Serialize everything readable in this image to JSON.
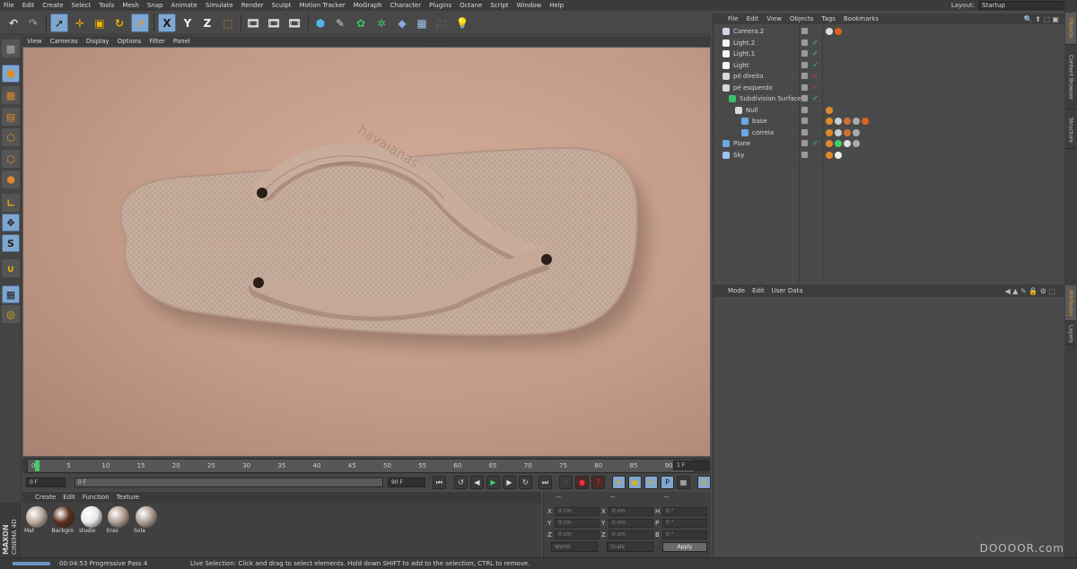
{
  "menu": [
    "File",
    "Edit",
    "Create",
    "Select",
    "Tools",
    "Mesh",
    "Snap",
    "Animate",
    "Simulate",
    "Render",
    "Sculpt",
    "Motion Tracker",
    "MoGraph",
    "Character",
    "Plugins",
    "Octane",
    "Script",
    "Window",
    "Help"
  ],
  "layout": {
    "label": "Layout:",
    "value": "Startup"
  },
  "viewport_menu": [
    "View",
    "Cameras",
    "Display",
    "Options",
    "Filter",
    "Panel"
  ],
  "sandal_logo": "havaianas",
  "timeline": {
    "ticks": [
      "0",
      "5",
      "10",
      "15",
      "20",
      "25",
      "30",
      "35",
      "40",
      "45",
      "50",
      "55",
      "60",
      "65",
      "70",
      "75",
      "80",
      "85",
      "90"
    ],
    "current": "1 F"
  },
  "playback": {
    "start": "0 F",
    "range_start": "0 F",
    "range_end": "90 F",
    "end": "90 F"
  },
  "material_menu": [
    "Create",
    "Edit",
    "Function",
    "Texture"
  ],
  "materials": [
    {
      "label": "Mat",
      "color": "#b9a99a"
    },
    {
      "label": "Backgro",
      "color": "#5a2e1c"
    },
    {
      "label": "studio",
      "color": "#e8e8e8"
    },
    {
      "label": "tiras",
      "color": "#b09c8f"
    },
    {
      "label": "Sola",
      "color": "#ad9e94"
    }
  ],
  "coords": {
    "header": [
      "--",
      "--",
      "--"
    ],
    "rows": [
      {
        "a": "X",
        "v1": "0 cm",
        "b": "X",
        "v2": "0 cm",
        "c": "H",
        "v3": "0 °"
      },
      {
        "a": "Y",
        "v1": "0 cm",
        "b": "Y",
        "v2": "0 cm",
        "c": "P",
        "v3": "0 °"
      },
      {
        "a": "Z",
        "v1": "0 cm",
        "b": "Z",
        "v2": "0 cm",
        "c": "B",
        "v3": "0 °"
      }
    ],
    "world": "World",
    "scale": "Scale",
    "apply": "Apply"
  },
  "objects_menu": [
    "File",
    "Edit",
    "View",
    "Objects",
    "Tags",
    "Bookmarks"
  ],
  "objects": [
    {
      "name": "Camera.2",
      "indent": 0
    },
    {
      "name": "Light.2",
      "indent": 0
    },
    {
      "name": "Light.1",
      "indent": 0
    },
    {
      "name": "Light",
      "indent": 0
    },
    {
      "name": "pé direito",
      "indent": 0
    },
    {
      "name": "pé esquerdo",
      "indent": 0
    },
    {
      "name": "Subdivision Surface",
      "indent": 1
    },
    {
      "name": "Null",
      "indent": 2
    },
    {
      "name": "base",
      "indent": 3
    },
    {
      "name": "correia",
      "indent": 3
    },
    {
      "name": "Plane",
      "indent": 0
    },
    {
      "name": "Sky",
      "indent": 0
    }
  ],
  "attr_menu": [
    "Mode",
    "Edit",
    "User Data"
  ],
  "right_tabs": [
    "Objects",
    "Content Browser",
    "Structure",
    "Attributes",
    "Layers"
  ],
  "status": {
    "time": "00:04:53 Progressive Pass 4",
    "hint": "Live Selection: Click and drag to select elements. Hold down SHIFT to add to the selection, CTRL to remove."
  },
  "branding": {
    "maxon": "MAXON",
    "c4d": "CINEMA 4D"
  },
  "watermark": "DOOOOR.com"
}
